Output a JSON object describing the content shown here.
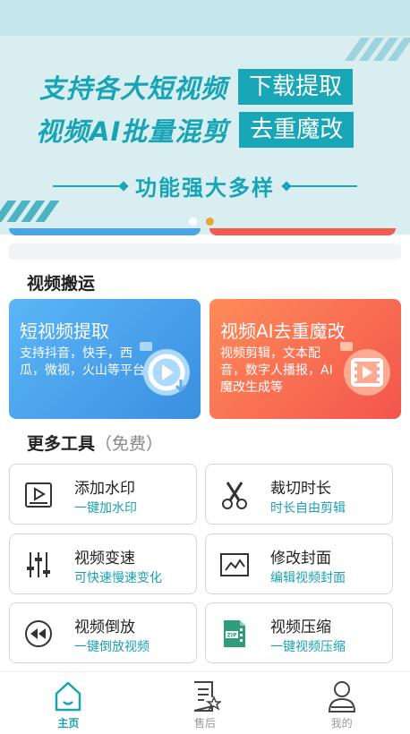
{
  "banner": {
    "line1": "支持各大短视频",
    "line1_box": "下载提取",
    "line2": "视频AI批量混剪",
    "line2_box": "去重魔改",
    "subtitle": "功能强大多样"
  },
  "sections": {
    "video_transfer": "视频搬运",
    "more_tools": "更多工具",
    "more_tools_note": "（免费）"
  },
  "features": [
    {
      "title": "短视频提取",
      "desc": "支持抖音，快手，西瓜，微视，火山等平台"
    },
    {
      "title": "视频AI去重魔改",
      "desc": "视频剪辑，文本配音，数字人播报，AI魔改生成等"
    }
  ],
  "tools": [
    {
      "name": "添加水印",
      "sub": "一键加水印",
      "icon": "video-watermark-icon"
    },
    {
      "name": "裁切时长",
      "sub": "时长自由剪辑",
      "icon": "scissors-icon"
    },
    {
      "name": "视频变速",
      "sub": "可快速慢速变化",
      "icon": "sliders-icon"
    },
    {
      "name": "修改封面",
      "sub": "编辑视频封面",
      "icon": "image-cover-icon"
    },
    {
      "name": "视频倒放",
      "sub": "一键倒放视频",
      "icon": "rewind-icon"
    },
    {
      "name": "视频压缩",
      "sub": "一键视频压缩",
      "icon": "zip-icon"
    }
  ],
  "tabbar": [
    {
      "label": "主页",
      "icon": "home-icon",
      "active": true
    },
    {
      "label": "售后",
      "icon": "document-star-icon",
      "active": false
    },
    {
      "label": "我的",
      "icon": "user-icon",
      "active": false
    }
  ],
  "colors": {
    "accent": "#1aa1b3",
    "banner_bg": "#d9eef0",
    "blue_card": "#3a8fe0",
    "orange_card": "#f3554c",
    "dot_active": "#e8a630"
  }
}
